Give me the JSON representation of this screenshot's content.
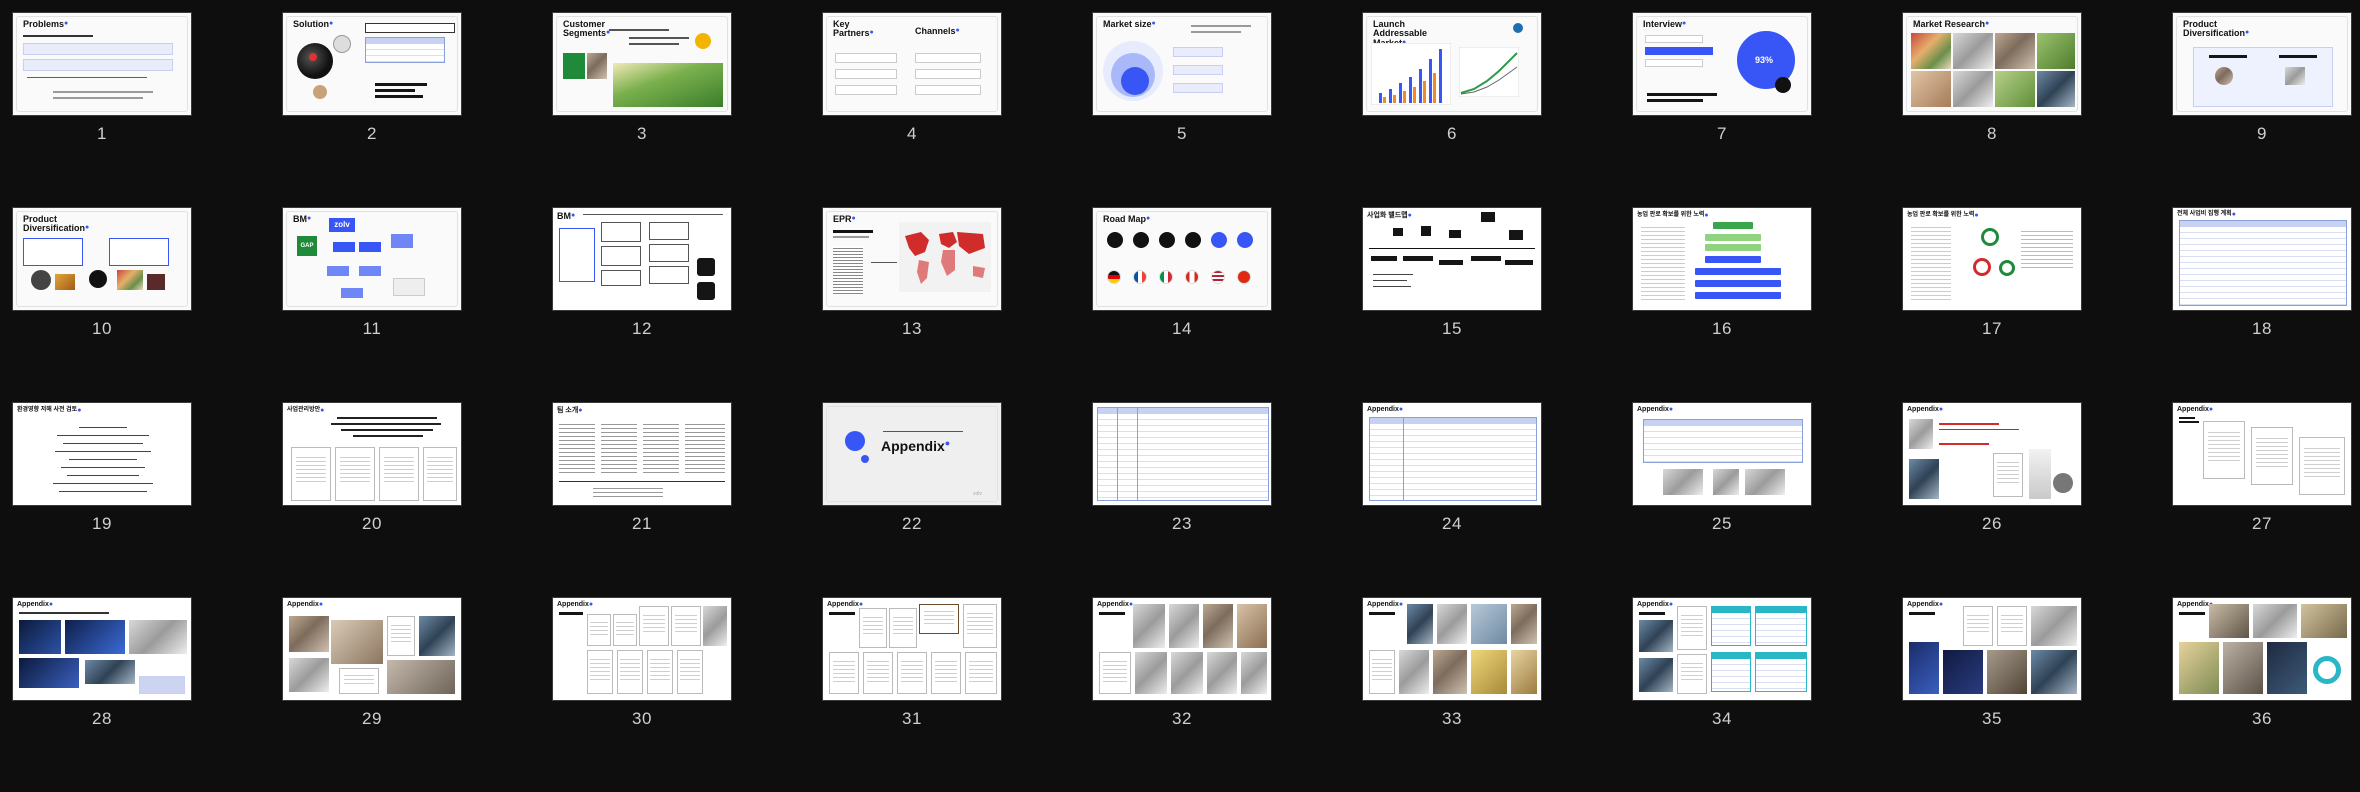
{
  "slides": [
    {
      "n": "1",
      "title": "Problems"
    },
    {
      "n": "2",
      "title": "Solution"
    },
    {
      "n": "3",
      "title": "Customer Segments"
    },
    {
      "n": "4",
      "title": "Key Partners",
      "title2": "Channels"
    },
    {
      "n": "5",
      "title": "Market size"
    },
    {
      "n": "6",
      "title": "Launch Addressable Market"
    },
    {
      "n": "7",
      "title": "Interview",
      "stat": "93%"
    },
    {
      "n": "8",
      "title": "Market Research"
    },
    {
      "n": "9",
      "title": "Product Diversification"
    },
    {
      "n": "10",
      "title": "Product Diversification"
    },
    {
      "n": "11",
      "title": "BM",
      "brand": "zolv",
      "badge": "GAP"
    },
    {
      "n": "12",
      "title": "BM"
    },
    {
      "n": "13",
      "title": "EPR"
    },
    {
      "n": "14",
      "title": "Road Map"
    },
    {
      "n": "15",
      "title": "사업화 밸드맵"
    },
    {
      "n": "16",
      "title": "농업 판로 확보를 위한 노력"
    },
    {
      "n": "17",
      "title": "농업 판로 확보를 위한 노력"
    },
    {
      "n": "18",
      "title": "전체 사업비 집행 계획"
    },
    {
      "n": "19",
      "title": "환경영향 저해 사전 검토"
    },
    {
      "n": "20",
      "title": "사업관리방안"
    },
    {
      "n": "21",
      "title": "팀 소개"
    },
    {
      "n": "22",
      "title": "Appendix"
    },
    {
      "n": "23",
      "title": ""
    },
    {
      "n": "24",
      "title": "Appendix"
    },
    {
      "n": "25",
      "title": "Appendix"
    },
    {
      "n": "26",
      "title": "Appendix"
    },
    {
      "n": "27",
      "title": "Appendix"
    },
    {
      "n": "28",
      "title": "Appendix"
    },
    {
      "n": "29",
      "title": "Appendix"
    },
    {
      "n": "30",
      "title": "Appendix"
    },
    {
      "n": "31",
      "title": "Appendix"
    },
    {
      "n": "32",
      "title": "Appendix"
    },
    {
      "n": "33",
      "title": "Appendix"
    },
    {
      "n": "34",
      "title": "Appendix"
    },
    {
      "n": "35",
      "title": "Appendix"
    },
    {
      "n": "36",
      "title": "Appendix"
    }
  ],
  "colors": {
    "background": "#0e0e0e",
    "accent": "#3856f5",
    "slide": "#fafafa"
  }
}
